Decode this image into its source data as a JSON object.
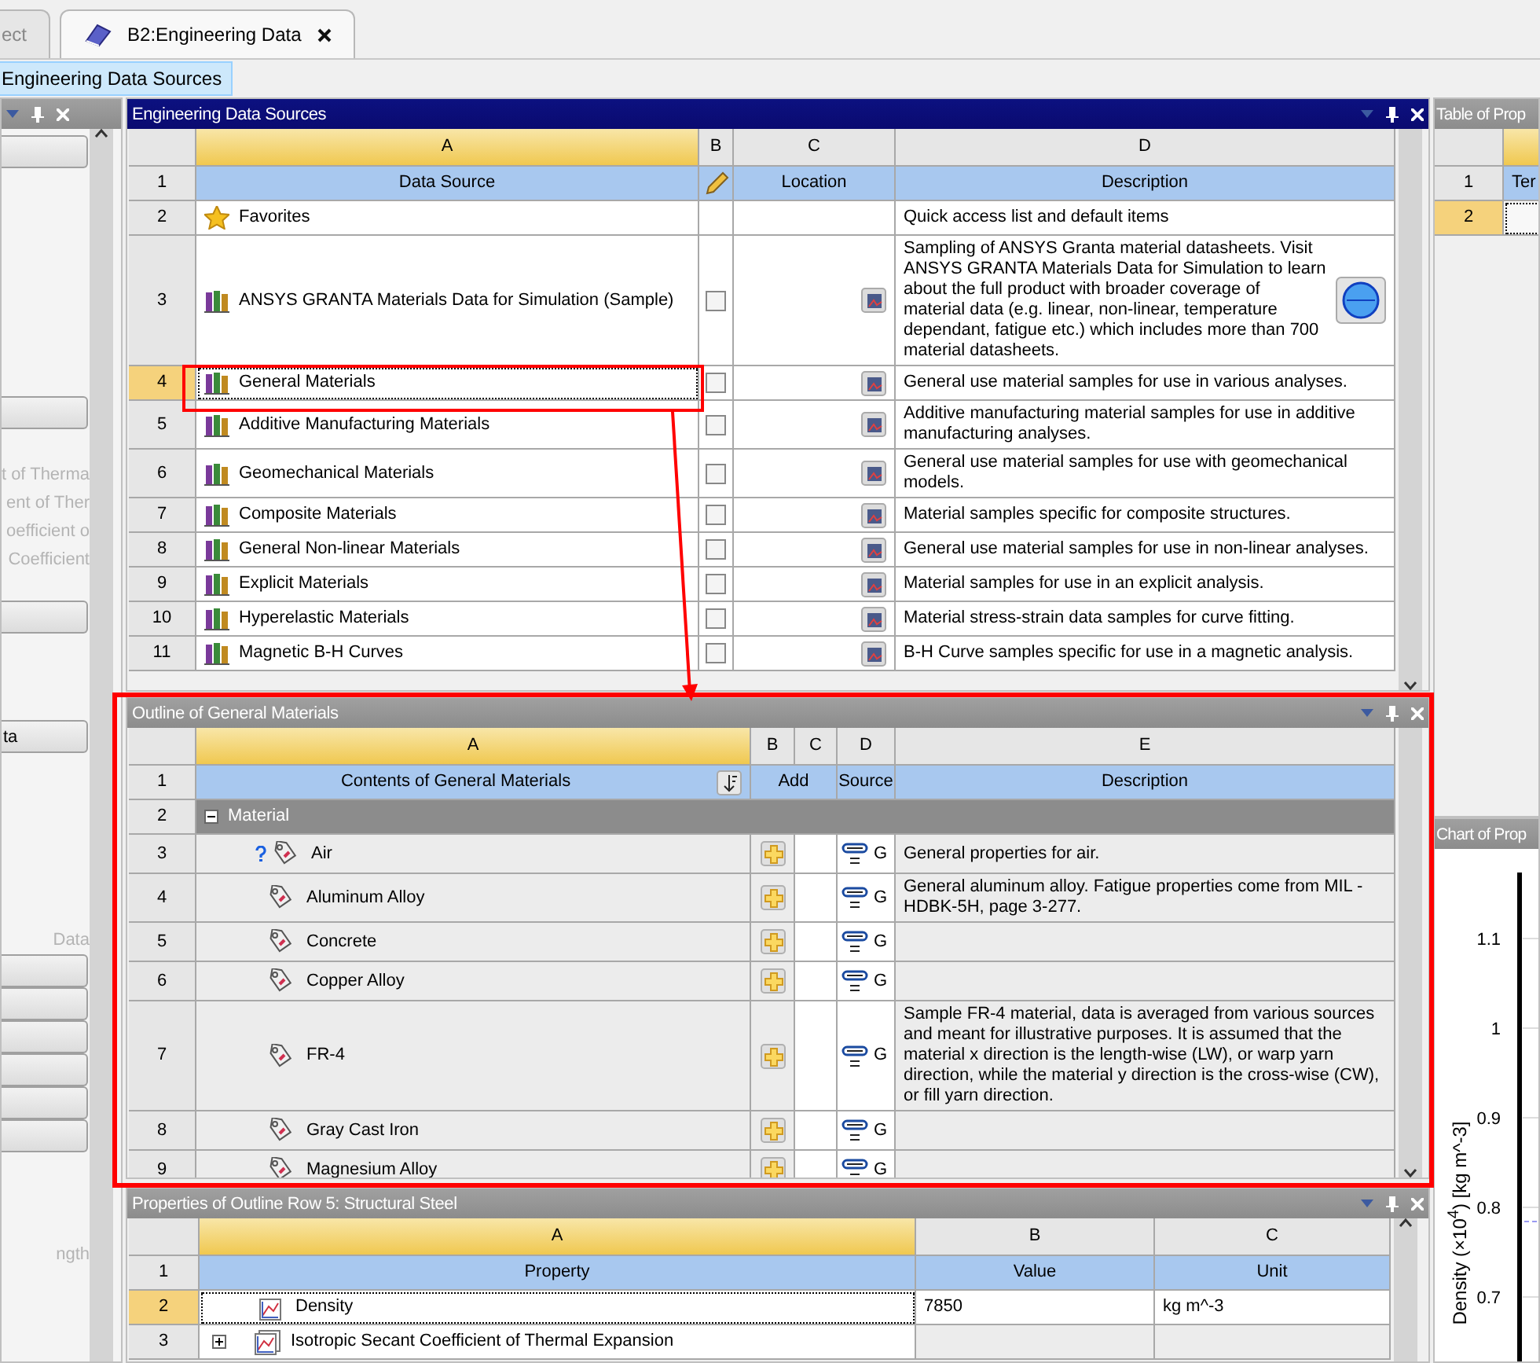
{
  "tabs": [
    {
      "label": "ect",
      "selected": false
    },
    {
      "label": "B2:Engineering Data",
      "selected": true
    }
  ],
  "toolbar": {
    "buttons": [
      {
        "label": "Engineering Data Sources",
        "selected": true
      }
    ]
  },
  "left_panel": {
    "items": [
      {
        "kind": "button"
      },
      {
        "kind": "button"
      },
      {
        "kind": "text",
        "text": "t of Therma"
      },
      {
        "kind": "text",
        "text": "ent of Ther"
      },
      {
        "kind": "text",
        "text": "oefficient o"
      },
      {
        "kind": "text",
        "text": "Coefficient"
      },
      {
        "kind": "button"
      },
      {
        "kind": "button",
        "label": "ta"
      },
      {
        "kind": "text",
        "text": "Data"
      },
      {
        "kind": "button"
      },
      {
        "kind": "button"
      },
      {
        "kind": "button"
      },
      {
        "kind": "button"
      },
      {
        "kind": "button"
      },
      {
        "kind": "button"
      },
      {
        "kind": "text",
        "text": "ngth"
      }
    ]
  },
  "sources": {
    "title": "Engineering Data Sources",
    "active": true,
    "columns": [
      "A",
      "B",
      "C",
      "D"
    ],
    "header": {
      "num": "1",
      "data_source": "Data Source",
      "location": "Location",
      "description": "Description"
    },
    "rows": [
      {
        "num": "2",
        "kind": "favorites",
        "name": "Favorites",
        "description": "Quick access list and default items",
        "selected": false
      },
      {
        "num": "3",
        "kind": "library",
        "name": "ANSYS GRANTA Materials Data for Simulation (Sample)",
        "checked": false,
        "web_link": true,
        "selected": false,
        "description": "Sampling of ANSYS Granta material datasheets. Visit ANSYS GRANTA Materials Data for Simulation to learn about the full product with broader coverage of material data (e.g. linear, non-linear, temperature dependant, fatigue etc.) which includes more than 700 material datasheets."
      },
      {
        "num": "4",
        "kind": "library",
        "name": "General Materials",
        "checked": false,
        "web_link": false,
        "selected": true,
        "description": "General use material samples for use in various analyses."
      },
      {
        "num": "5",
        "kind": "library",
        "name": "Additive Manufacturing Materials",
        "checked": false,
        "web_link": false,
        "selected": false,
        "description": "Additive manufacturing material samples for use in additive manufacturing analyses."
      },
      {
        "num": "6",
        "kind": "library",
        "name": "Geomechanical Materials",
        "checked": false,
        "web_link": false,
        "selected": false,
        "description": "General use material samples for use with geomechanical models."
      },
      {
        "num": "7",
        "kind": "library",
        "name": "Composite Materials",
        "checked": false,
        "web_link": false,
        "selected": false,
        "description": "Material samples specific for composite structures."
      },
      {
        "num": "8",
        "kind": "library",
        "name": "General Non-linear Materials",
        "checked": false,
        "web_link": false,
        "selected": false,
        "description": "General use material samples for use in non-linear analyses."
      },
      {
        "num": "9",
        "kind": "library",
        "name": "Explicit Materials",
        "checked": false,
        "web_link": false,
        "selected": false,
        "description": "Material samples for use in an explicit analysis."
      },
      {
        "num": "10",
        "kind": "library",
        "name": "Hyperelastic Materials",
        "checked": false,
        "web_link": false,
        "selected": false,
        "description": "Material stress-strain data samples for curve fitting."
      },
      {
        "num": "11",
        "kind": "library",
        "name": "Magnetic B-H Curves",
        "checked": false,
        "web_link": false,
        "selected": false,
        "description": "B-H Curve samples specific for use in a magnetic analysis."
      }
    ]
  },
  "outline": {
    "title": "Outline of General Materials",
    "active": false,
    "columns": [
      "A",
      "B",
      "C",
      "D",
      "E"
    ],
    "header": {
      "num": "1",
      "contents": "Contents of General Materials",
      "add": "Add",
      "source": "Source",
      "description": "Description"
    },
    "group": {
      "num": "2",
      "label": "Material",
      "expanded": true
    },
    "rows": [
      {
        "num": "3",
        "name": "Air",
        "help": true,
        "source": "G",
        "description": "General properties for air."
      },
      {
        "num": "4",
        "name": "Aluminum Alloy",
        "help": false,
        "source": "G",
        "description": "General aluminum alloy. Fatigue properties come from MIL -HDBK-5H, page 3-277."
      },
      {
        "num": "5",
        "name": "Concrete",
        "help": false,
        "source": "G"
      },
      {
        "num": "6",
        "name": "Copper Alloy",
        "help": false,
        "source": "G"
      },
      {
        "num": "7",
        "name": "FR-4",
        "help": false,
        "source": "G",
        "description": "Sample FR-4 material, data is averaged from various sources and meant for illustrative purposes. It is assumed that the material x direction is the length-wise (LW), or warp yarn direction, while the material y direction is the cross-wise (CW), or fill yarn direction."
      },
      {
        "num": "8",
        "name": "Gray Cast Iron",
        "help": false,
        "source": "G"
      },
      {
        "num": "9",
        "name": "Magnesium Alloy",
        "help": false,
        "source": "G"
      }
    ]
  },
  "properties": {
    "title": "Properties of Outline Row 5: Structural Steel",
    "active": false,
    "columns": [
      "A",
      "B",
      "C"
    ],
    "header": {
      "num": "1",
      "property": "Property",
      "value": "Value",
      "unit": "Unit"
    },
    "rows": [
      {
        "num": "2",
        "kind": "property",
        "name": "Density",
        "value": "7850",
        "unit": "kg m^-3",
        "selected": true
      },
      {
        "num": "3",
        "kind": "group",
        "name": "Isotropic Secant Coefficient of Thermal Expansion",
        "expanded": false,
        "selected": false
      }
    ]
  },
  "table_panel": {
    "title": "Table of Prop",
    "rows": [
      {
        "num": "1",
        "text": "Ter",
        "selected": false
      },
      {
        "num": "2",
        "selected": true
      }
    ]
  },
  "chart_panel": {
    "title": "Chart of Prop",
    "axis_label": "Density  (×10$^{4}$)  [kg m^-3]",
    "tick_labels": [
      "1.1",
      "1",
      "0.9",
      "0.8",
      "0.7"
    ]
  }
}
